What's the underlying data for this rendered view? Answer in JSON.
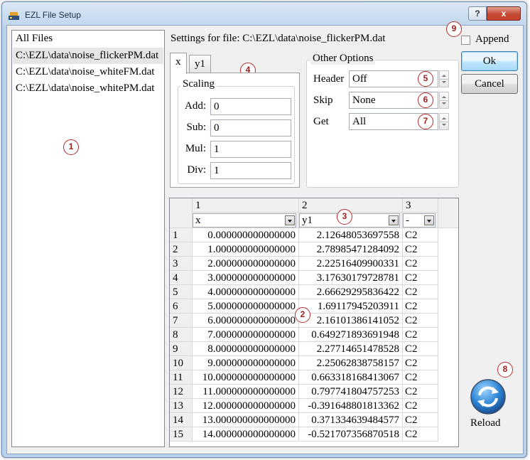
{
  "window": {
    "title": "EZL File Setup"
  },
  "titlebar": {
    "help_label": "?",
    "close_label": "x"
  },
  "files": {
    "header": "All Files",
    "items": [
      "C:\\EZL\\data\\noise_flickerPM.dat",
      "C:\\EZL\\data\\noise_whiteFM.dat",
      "C:\\EZL\\data\\noise_whitePM.dat"
    ]
  },
  "settings": {
    "label": "Settings for file: C:\\EZL\\data\\noise_flickerPM.dat"
  },
  "tabs": [
    "x",
    "y1"
  ],
  "scaling": {
    "title": "Scaling",
    "fields": [
      {
        "label": "Add:",
        "value": "0"
      },
      {
        "label": "Sub:",
        "value": "0"
      },
      {
        "label": "Mul:",
        "value": "1"
      },
      {
        "label": "Div:",
        "value": "1"
      }
    ]
  },
  "other_options": {
    "title": "Other Options",
    "fields": [
      {
        "label": "Header",
        "value": "Off"
      },
      {
        "label": "Skip",
        "value": "None"
      },
      {
        "label": "Get",
        "value": "All"
      }
    ]
  },
  "append": {
    "label": "Append",
    "checked": false
  },
  "buttons": {
    "ok": "Ok",
    "cancel": "Cancel",
    "reload": "Reload"
  },
  "grid": {
    "column_numbers": [
      "1",
      "2",
      "3"
    ],
    "column_selects": [
      "x",
      "y1",
      "-"
    ],
    "rows": [
      {
        "n": "1",
        "x": "0.000000000000000",
        "y": "2.12648053697558",
        "c": "C2"
      },
      {
        "n": "2",
        "x": "1.000000000000000",
        "y": "2.78985471284092",
        "c": "C2"
      },
      {
        "n": "3",
        "x": "2.000000000000000",
        "y": "2.22516409900331",
        "c": "C2"
      },
      {
        "n": "4",
        "x": "3.000000000000000",
        "y": "3.17630179728781",
        "c": "C2"
      },
      {
        "n": "5",
        "x": "4.000000000000000",
        "y": "2.66629295836422",
        "c": "C2"
      },
      {
        "n": "6",
        "x": "5.000000000000000",
        "y": "1.69117945203911",
        "c": "C2"
      },
      {
        "n": "7",
        "x": "6.000000000000000",
        "y": "2.16101386141052",
        "c": "C2"
      },
      {
        "n": "8",
        "x": "7.000000000000000",
        "y": "0.649271893691948",
        "c": "C2"
      },
      {
        "n": "9",
        "x": "8.000000000000000",
        "y": "2.27714651478528",
        "c": "C2"
      },
      {
        "n": "10",
        "x": "9.000000000000000",
        "y": "2.25062838758157",
        "c": "C2"
      },
      {
        "n": "11",
        "x": "10.000000000000000",
        "y": "0.663318168413067",
        "c": "C2"
      },
      {
        "n": "12",
        "x": "11.000000000000000",
        "y": "0.797741804757253",
        "c": "C2"
      },
      {
        "n": "13",
        "x": "12.000000000000000",
        "y": "-0.391648801813362",
        "c": "C2"
      },
      {
        "n": "14",
        "x": "13.000000000000000",
        "y": "0.371334639484577",
        "c": "C2"
      },
      {
        "n": "15",
        "x": "14.000000000000000",
        "y": "-0.521707356870518",
        "c": "C2"
      }
    ]
  },
  "annotations": [
    "1",
    "2",
    "3",
    "4",
    "5",
    "6",
    "7",
    "8",
    "9"
  ],
  "colors": {
    "window_frame": "#b9d1ea",
    "annotation": "#b52a2a",
    "default_button": "#bee6fd"
  }
}
